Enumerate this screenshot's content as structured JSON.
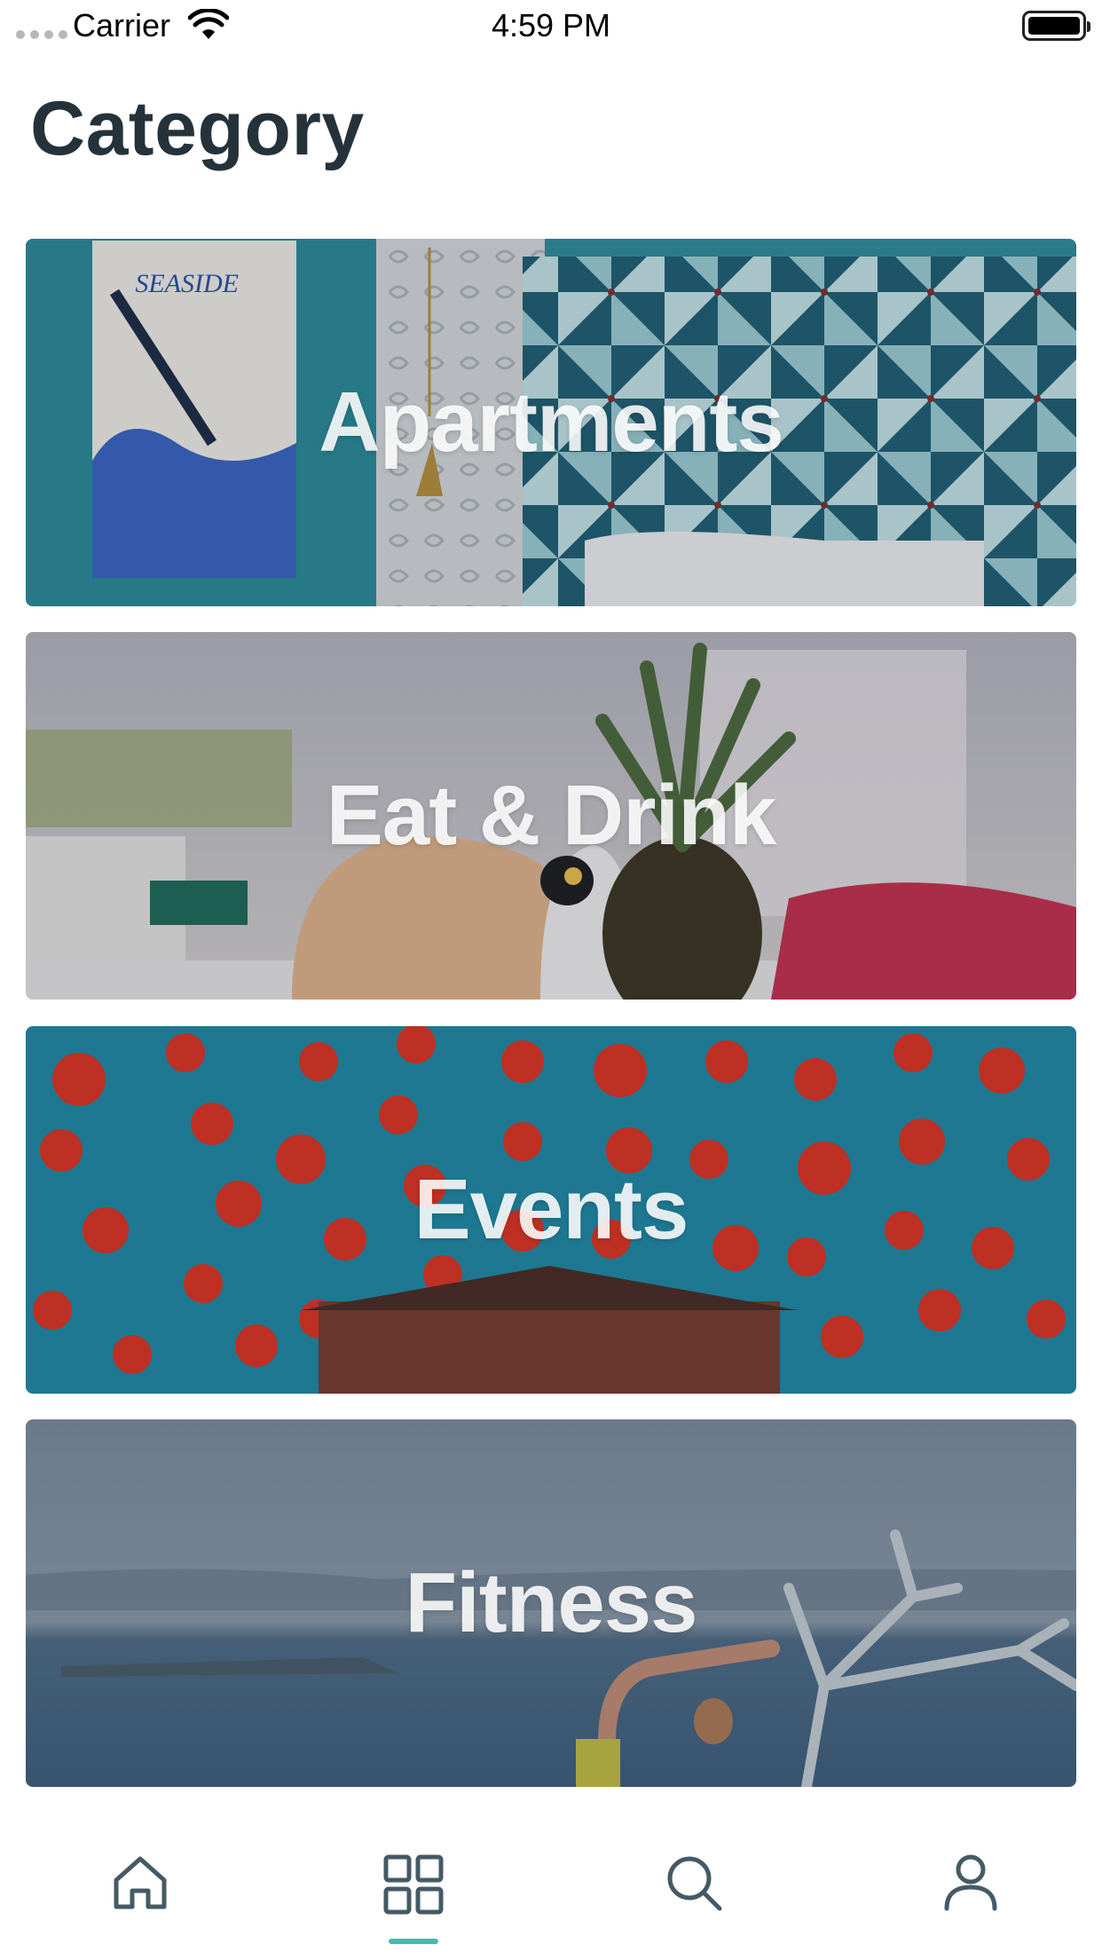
{
  "status_bar": {
    "carrier": "Carrier",
    "time": "4:59 PM"
  },
  "page": {
    "title": "Category"
  },
  "categories": [
    {
      "label": "Apartments"
    },
    {
      "label": "Eat & Drink"
    },
    {
      "label": "Events"
    },
    {
      "label": "Fitness"
    }
  ],
  "tab_bar": {
    "tabs": [
      {
        "icon": "home-icon",
        "active": false
      },
      {
        "icon": "grid-icon",
        "active": true
      },
      {
        "icon": "search-icon",
        "active": false
      },
      {
        "icon": "profile-icon",
        "active": false
      }
    ],
    "active_color": "#3dbdaa",
    "icon_color": "#455a64"
  }
}
